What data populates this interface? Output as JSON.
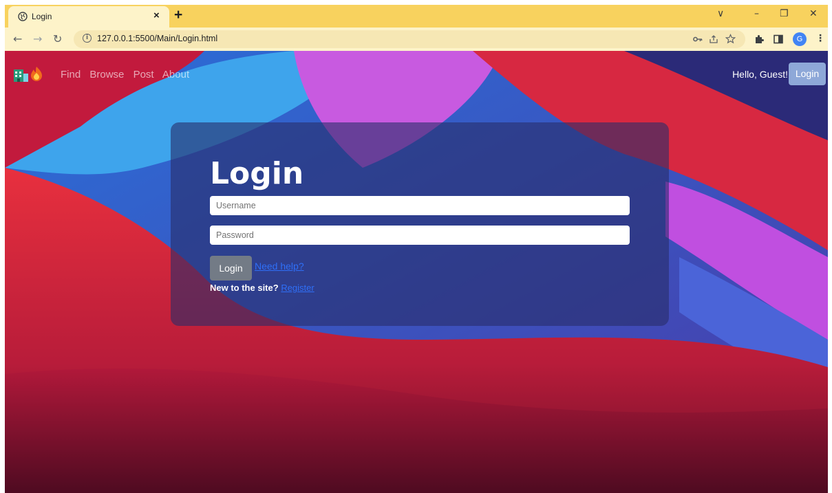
{
  "browser": {
    "tab_title": "Login",
    "tab_close": "×",
    "new_tab": "+",
    "url": "127.0.0.1:5500/Main/Login.html",
    "profile_initial": "G",
    "window_controls": {
      "dropdown": "∨",
      "minimize": "–",
      "restore": "❐",
      "close": "✕"
    }
  },
  "navbar": {
    "brand_icons": [
      "building-icon",
      "fire-icon"
    ],
    "links": [
      "Find",
      "Browse",
      "Post",
      "About"
    ],
    "greeting": "Hello, Guest!",
    "login_button": "Login"
  },
  "login_card": {
    "heading": "Login",
    "username_placeholder": "Username",
    "password_placeholder": "Password",
    "submit_label": "Login",
    "help_link": "Need help?",
    "register_prompt": "New to the site?",
    "register_link": "Register"
  },
  "colors": {
    "tab_bar": "#f8d25e",
    "toolbar": "#fdf3c9",
    "link": "#2f6ff7",
    "card_bg": "rgba(40,45,105,0.6)",
    "nav_login_bg": "#8ea8d8",
    "submit_bg": "#737b86"
  }
}
